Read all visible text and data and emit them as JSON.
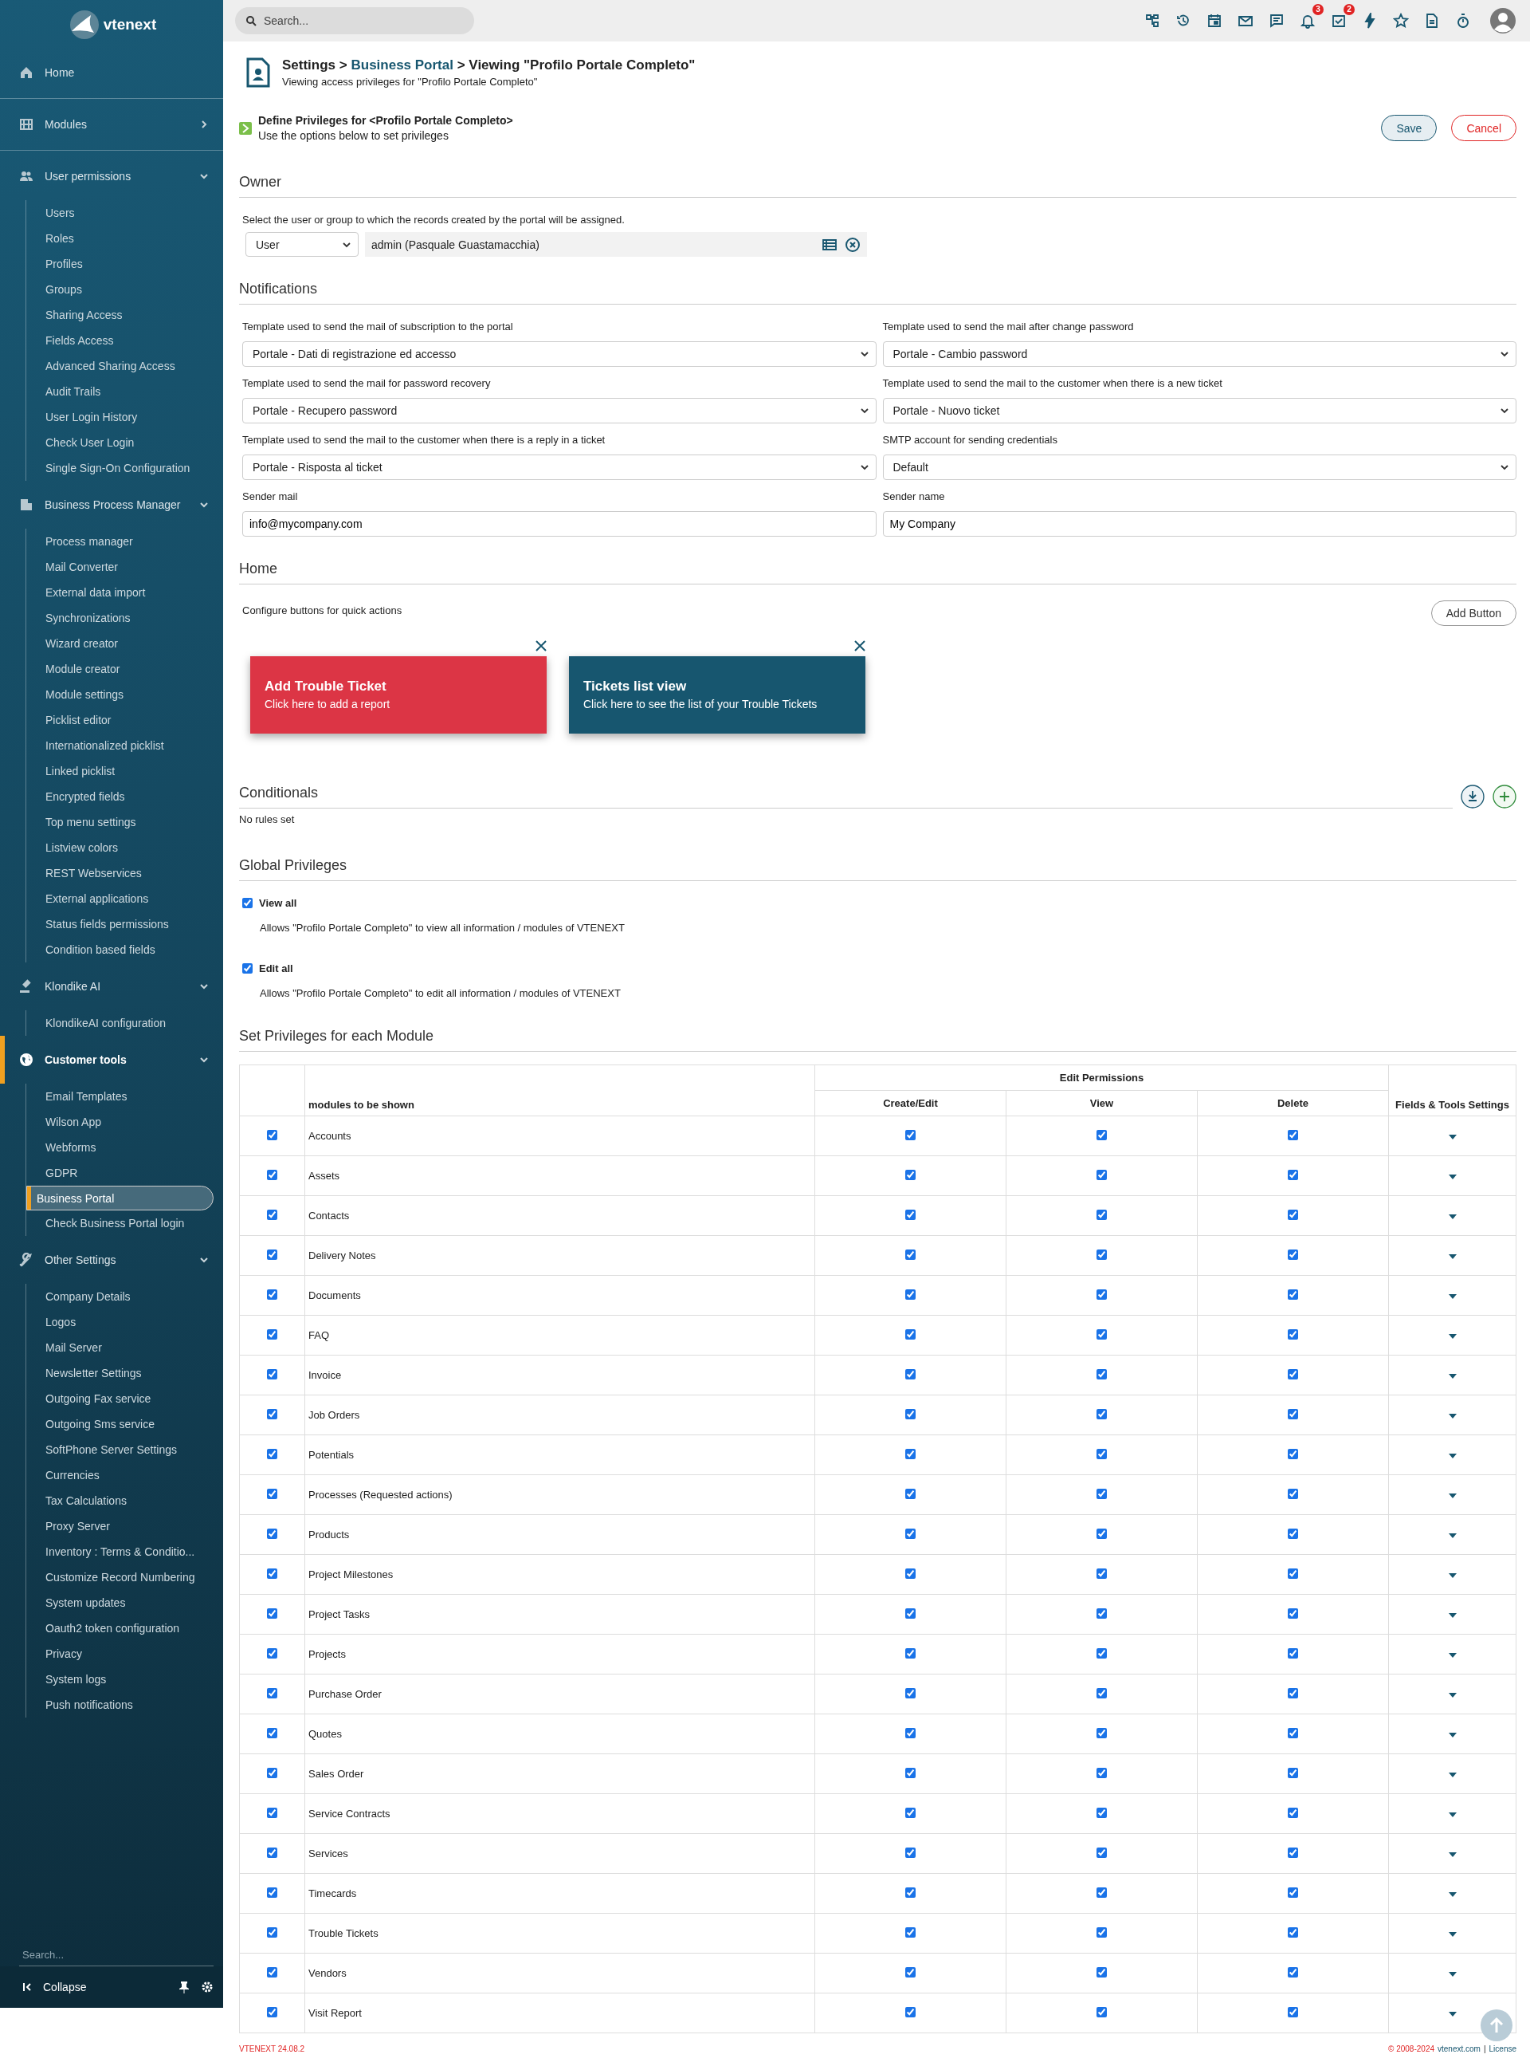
{
  "sidebar": {
    "logo": "vtenext",
    "sections": [
      {
        "label": "Home"
      },
      {
        "label": "Modules",
        "expanded": false
      },
      {
        "label": "User permissions",
        "expanded": true,
        "items": [
          {
            "label": "Users",
            "selected": false
          },
          {
            "label": "Roles",
            "selected": false
          },
          {
            "label": "Profiles",
            "selected": false
          },
          {
            "label": "Groups",
            "selected": false
          },
          {
            "label": "Sharing Access",
            "selected": false
          },
          {
            "label": "Fields Access",
            "selected": false
          },
          {
            "label": "Advanced Sharing Access",
            "selected": false
          },
          {
            "label": "Audit Trails",
            "selected": false
          },
          {
            "label": "User Login History",
            "selected": false
          },
          {
            "label": "Check User Login",
            "selected": false
          },
          {
            "label": "Single Sign-On Configuration",
            "selected": false
          }
        ]
      },
      {
        "label": "Business Process Manager",
        "expanded": true,
        "items": [
          {
            "label": "Process manager",
            "selected": false
          },
          {
            "label": "Mail Converter",
            "selected": false
          },
          {
            "label": "External data import",
            "selected": false
          },
          {
            "label": "Synchronizations",
            "selected": false
          },
          {
            "label": "Wizard creator",
            "selected": false
          },
          {
            "label": "Module creator",
            "selected": false
          },
          {
            "label": "Module settings",
            "selected": false
          },
          {
            "label": "Picklist editor",
            "selected": false
          },
          {
            "label": "Internationalized picklist",
            "selected": false
          },
          {
            "label": "Linked picklist",
            "selected": false
          },
          {
            "label": "Encrypted fields",
            "selected": false
          },
          {
            "label": "Top menu settings",
            "selected": false
          },
          {
            "label": "Listview colors",
            "selected": false
          },
          {
            "label": "REST Webservices",
            "selected": false
          },
          {
            "label": "External applications",
            "selected": false
          },
          {
            "label": "Status fields permissions",
            "selected": false
          },
          {
            "label": "Condition based fields",
            "selected": false
          }
        ]
      },
      {
        "label": "Klondike AI",
        "expanded": true,
        "items": [
          {
            "label": "KlondikeAI configuration",
            "selected": false
          }
        ]
      },
      {
        "label": "Customer tools",
        "expanded": true,
        "selected": true,
        "items": [
          {
            "label": "Email Templates",
            "selected": false
          },
          {
            "label": "Wilson App",
            "selected": false
          },
          {
            "label": "Webforms",
            "selected": false
          },
          {
            "label": "GDPR",
            "selected": false
          },
          {
            "label": "Business Portal",
            "selected": true
          },
          {
            "label": "Check Business Portal login",
            "selected": false
          }
        ]
      },
      {
        "label": "Other Settings",
        "expanded": true,
        "items": [
          {
            "label": "Company Details",
            "selected": false
          },
          {
            "label": "Logos",
            "selected": false
          },
          {
            "label": "Mail Server",
            "selected": false
          },
          {
            "label": "Newsletter Settings",
            "selected": false
          },
          {
            "label": "Outgoing Fax service",
            "selected": false
          },
          {
            "label": "Outgoing Sms service",
            "selected": false
          },
          {
            "label": "SoftPhone Server Settings",
            "selected": false
          },
          {
            "label": "Currencies",
            "selected": false
          },
          {
            "label": "Tax Calculations",
            "selected": false
          },
          {
            "label": "Proxy Server",
            "selected": false
          },
          {
            "label": "Inventory : Terms & Conditio...",
            "selected": false
          },
          {
            "label": "Customize Record Numbering",
            "selected": false
          },
          {
            "label": "System updates",
            "selected": false
          },
          {
            "label": "Oauth2 token configuration",
            "selected": false
          },
          {
            "label": "Privacy",
            "selected": false
          },
          {
            "label": "System logs",
            "selected": false
          },
          {
            "label": "Push notifications",
            "selected": false
          }
        ]
      }
    ],
    "search_placeholder": "Search...",
    "collapse": "Collapse"
  },
  "topbar": {
    "search_placeholder": "Search...",
    "notifications_badge": "3",
    "tasks_badge": "2"
  },
  "header": {
    "breadcrumb_root": "Settings",
    "separator": ">",
    "breadcrumb_link": "Business Portal",
    "breadcrumb_current": "> Viewing \"Profilo Portale Completo\"",
    "subtitle": "Viewing access privileges for \"Profilo Portale Completo\"",
    "define_title": "Define Privileges for <Profilo Portale Completo>",
    "define_subtitle": "Use the options below to set privileges",
    "save": "Save",
    "cancel": "Cancel"
  },
  "owner": {
    "heading": "Owner",
    "label": "Select the user or group to which the records created by the portal will be assigned.",
    "type": "User",
    "value": "admin (Pasquale Guastamacchia)"
  },
  "notifications": {
    "heading": "Notifications",
    "fields": [
      {
        "label": "Template used to send the mail of subscription to the portal",
        "kind": "select",
        "value": "Portale - Dati di registrazione ed accesso"
      },
      {
        "label": "Template used to send the mail after change password",
        "kind": "select",
        "value": "Portale - Cambio password"
      },
      {
        "label": "Template used to send the mail for password recovery",
        "kind": "select",
        "value": "Portale - Recupero password"
      },
      {
        "label": "Template used to send the mail to the customer when there is a new ticket",
        "kind": "select",
        "value": "Portale - Nuovo ticket"
      },
      {
        "label": "Template used to send the mail to the customer when there is a reply in a ticket",
        "kind": "select",
        "value": "Portale - Risposta al ticket"
      },
      {
        "label": "SMTP account for sending credentials",
        "kind": "select",
        "value": "Default"
      },
      {
        "label": "Sender mail",
        "kind": "input",
        "value": "info@mycompany.com"
      },
      {
        "label": "Sender name",
        "kind": "input",
        "value": "My Company"
      }
    ]
  },
  "home": {
    "heading": "Home",
    "description": "Configure buttons for quick actions",
    "add_button": "Add Button",
    "quick_actions": [
      {
        "title": "Add Trouble Ticket",
        "subtitle": "Click here to add a report",
        "color": "#dc3545"
      },
      {
        "title": "Tickets list view",
        "subtitle": "Click here to see the list of your Trouble Tickets",
        "color": "#17566f"
      }
    ]
  },
  "conditionals": {
    "heading": "Conditionals",
    "empty_text": "No rules set"
  },
  "global_privileges": {
    "heading": "Global Privileges",
    "items": [
      {
        "label": "View all",
        "checked": true,
        "description": "Allows \"Profilo Portale Completo\" to view all information / modules of VTENEXT"
      },
      {
        "label": "Edit all",
        "checked": true,
        "description": "Allows \"Profilo Portale Completo\" to edit all information / modules of VTENEXT"
      }
    ]
  },
  "modules_table": {
    "heading": "Set Privileges for each Module",
    "group_header": "Edit Permissions",
    "columns": [
      "modules to be shown",
      "Create/Edit",
      "View",
      "Delete",
      "Fields & Tools Settings"
    ],
    "rows": [
      {
        "name": "Accounts",
        "shown": true,
        "create_edit": true,
        "view": true,
        "delete": true
      },
      {
        "name": "Assets",
        "shown": true,
        "create_edit": true,
        "view": true,
        "delete": true
      },
      {
        "name": "Contacts",
        "shown": true,
        "create_edit": true,
        "view": true,
        "delete": true
      },
      {
        "name": "Delivery Notes",
        "shown": true,
        "create_edit": true,
        "view": true,
        "delete": true
      },
      {
        "name": "Documents",
        "shown": true,
        "create_edit": true,
        "view": true,
        "delete": true
      },
      {
        "name": "FAQ",
        "shown": true,
        "create_edit": true,
        "view": true,
        "delete": true
      },
      {
        "name": "Invoice",
        "shown": true,
        "create_edit": true,
        "view": true,
        "delete": true
      },
      {
        "name": "Job Orders",
        "shown": true,
        "create_edit": true,
        "view": true,
        "delete": true
      },
      {
        "name": "Potentials",
        "shown": true,
        "create_edit": true,
        "view": true,
        "delete": true
      },
      {
        "name": "Processes (Requested actions)",
        "shown": true,
        "create_edit": true,
        "view": true,
        "delete": true
      },
      {
        "name": "Products",
        "shown": true,
        "create_edit": true,
        "view": true,
        "delete": true
      },
      {
        "name": "Project Milestones",
        "shown": true,
        "create_edit": true,
        "view": true,
        "delete": true
      },
      {
        "name": "Project Tasks",
        "shown": true,
        "create_edit": true,
        "view": true,
        "delete": true
      },
      {
        "name": "Projects",
        "shown": true,
        "create_edit": true,
        "view": true,
        "delete": true
      },
      {
        "name": "Purchase Order",
        "shown": true,
        "create_edit": true,
        "view": true,
        "delete": true
      },
      {
        "name": "Quotes",
        "shown": true,
        "create_edit": true,
        "view": true,
        "delete": true
      },
      {
        "name": "Sales Order",
        "shown": true,
        "create_edit": true,
        "view": true,
        "delete": true
      },
      {
        "name": "Service Contracts",
        "shown": true,
        "create_edit": true,
        "view": true,
        "delete": true
      },
      {
        "name": "Services",
        "shown": true,
        "create_edit": true,
        "view": true,
        "delete": true
      },
      {
        "name": "Timecards",
        "shown": true,
        "create_edit": true,
        "view": true,
        "delete": true
      },
      {
        "name": "Trouble Tickets",
        "shown": true,
        "create_edit": true,
        "view": true,
        "delete": true
      },
      {
        "name": "Vendors",
        "shown": true,
        "create_edit": true,
        "view": true,
        "delete": true
      },
      {
        "name": "Visit Report",
        "shown": true,
        "create_edit": true,
        "view": true,
        "delete": true
      }
    ]
  },
  "footer": {
    "version": "VTENEXT 24.08.2",
    "copyright": "© 2008-2024",
    "site_link": "vtenext.com",
    "separator": "|",
    "license_link": "License"
  }
}
